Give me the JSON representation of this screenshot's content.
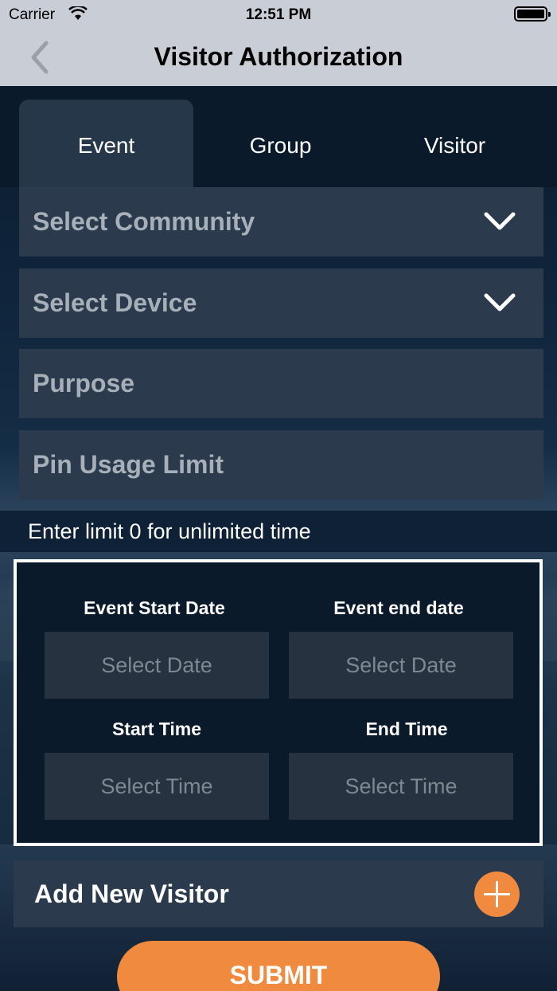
{
  "status_bar": {
    "carrier": "Carrier",
    "time": "12:51 PM"
  },
  "nav": {
    "title": "Visitor Authorization"
  },
  "tabs": [
    {
      "label": "Event",
      "active": true
    },
    {
      "label": "Group",
      "active": false
    },
    {
      "label": "Visitor",
      "active": false
    }
  ],
  "form": {
    "community": "Select Community",
    "device": "Select Device",
    "purpose": "Purpose",
    "pin_limit": "Pin Usage Limit",
    "hint": "Enter limit 0 for unlimited time"
  },
  "dates": {
    "start_date_label": "Event Start Date",
    "end_date_label": "Event end date",
    "start_date_placeholder": "Select Date",
    "end_date_placeholder": "Select Date",
    "start_time_label": "Start Time",
    "end_time_label": "End Time",
    "start_time_placeholder": "Select Time",
    "end_time_placeholder": "Select Time"
  },
  "add_visitor": {
    "label": "Add New Visitor"
  },
  "submit": {
    "label": "SUBMIT"
  },
  "colors": {
    "accent": "#f08a3e",
    "field_bg": "#2b3b4d",
    "nav_bg": "#c9ced6"
  }
}
